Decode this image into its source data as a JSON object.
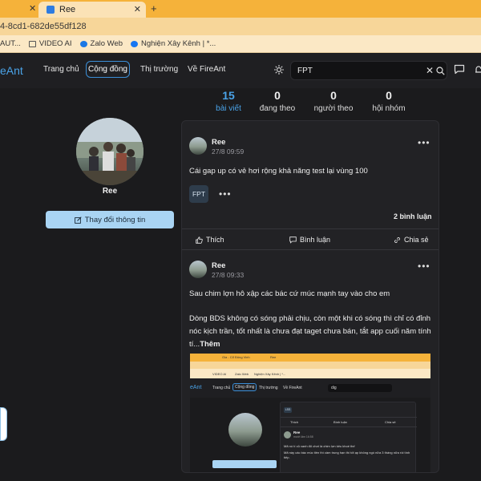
{
  "browser": {
    "tab_title": "Ree",
    "url_fragment": "4-8cd1-682de55df128",
    "bookmarks": [
      "AUT...",
      "VIDEO AI",
      "Zalo Web",
      "Nghiện Xây Kênh | *..."
    ]
  },
  "site": {
    "logo": "eAnt",
    "nav": [
      "Trang chủ",
      "Cộng đồng",
      "Thị trường",
      "Về FireAnt"
    ],
    "search_value": "FPT"
  },
  "profile": {
    "name": "Ree",
    "edit_label": "Thay đổi thông tin",
    "stats": [
      {
        "num": "15",
        "label": "bài viết"
      },
      {
        "num": "0",
        "label": "đang theo"
      },
      {
        "num": "0",
        "label": "người theo"
      },
      {
        "num": "0",
        "label": "hội nhóm"
      }
    ]
  },
  "posts": [
    {
      "author": "Ree",
      "time": "27/8 09:59",
      "text": "Cái gap up có vẻ hơi rộng khả năng test lại vùng 100",
      "tag": "FPT",
      "comments": "2 bình luận"
    },
    {
      "author": "Ree",
      "time": "27/8 09:33",
      "line1": "Sau chim lợn hô xập các bác cứ múc mạnh tay vào cho em",
      "line2": "Dòng BDS không có sóng phải chịu, còn một khi có sóng thì chỉ có đỉnh nóc kịch trần, tốt nhất là chưa đạt taget chưa bán, tắt app cuối năm tính tí...",
      "more": "Thêm"
    }
  ],
  "actions": {
    "like": "Thích",
    "comment": "Bình luận",
    "share": "Chia sẻ"
  },
  "embed": {
    "nav": [
      "Trang chủ",
      "Cộng đồng",
      "Thị trường",
      "Về FireAnt"
    ],
    "logo": "eAnt",
    "search": "dig",
    "name": "Ree",
    "tag": "LSS",
    "time": "mười lăm 16:58",
    "text1": "Mã nó tí củ xanh đỏ chơi là chim lợn kêu khoé thế",
    "text2": "Mã này các bác múc tiền thì cầm trung hạn thì tốt ạp không ngó nữa 3 tháng nữa rồi tính tiếp."
  },
  "colors": {
    "accent": "#4aa3e8",
    "bg": "#1b1b1d",
    "chrome": "#f5b23a"
  }
}
